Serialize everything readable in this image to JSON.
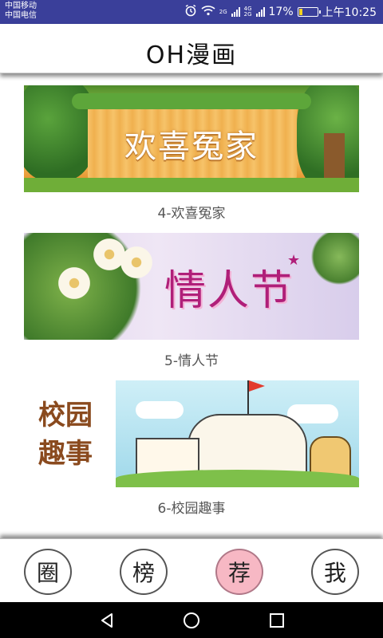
{
  "status_bar": {
    "carrier_1": "中国移动",
    "carrier_2": "中国电信",
    "network_1": "2G",
    "network_2": "4G",
    "network_3": "2G",
    "battery_level": 0.17,
    "battery_text": "17%",
    "time": "上午10:25"
  },
  "app_bar": {
    "title": "OH漫画"
  },
  "feed": {
    "items": [
      {
        "banner_text": "欢喜冤家",
        "caption": "4-欢喜冤家"
      },
      {
        "banner_text": "情人节",
        "caption": "5-情人节"
      },
      {
        "banner_text": "校园趣事",
        "caption": "6-校园趣事"
      }
    ]
  },
  "bottom_nav": {
    "items": [
      {
        "label": "圈",
        "active": false
      },
      {
        "label": "榜",
        "active": false
      },
      {
        "label": "荐",
        "active": true
      },
      {
        "label": "我",
        "active": false
      }
    ]
  },
  "colors": {
    "status_bar": "#3a3f9a",
    "active_tab": "#f7b8c4",
    "battery": "#f4d21f"
  },
  "icons": {
    "system_back": "back-icon",
    "system_home": "home-icon",
    "system_recents": "recents-icon"
  }
}
